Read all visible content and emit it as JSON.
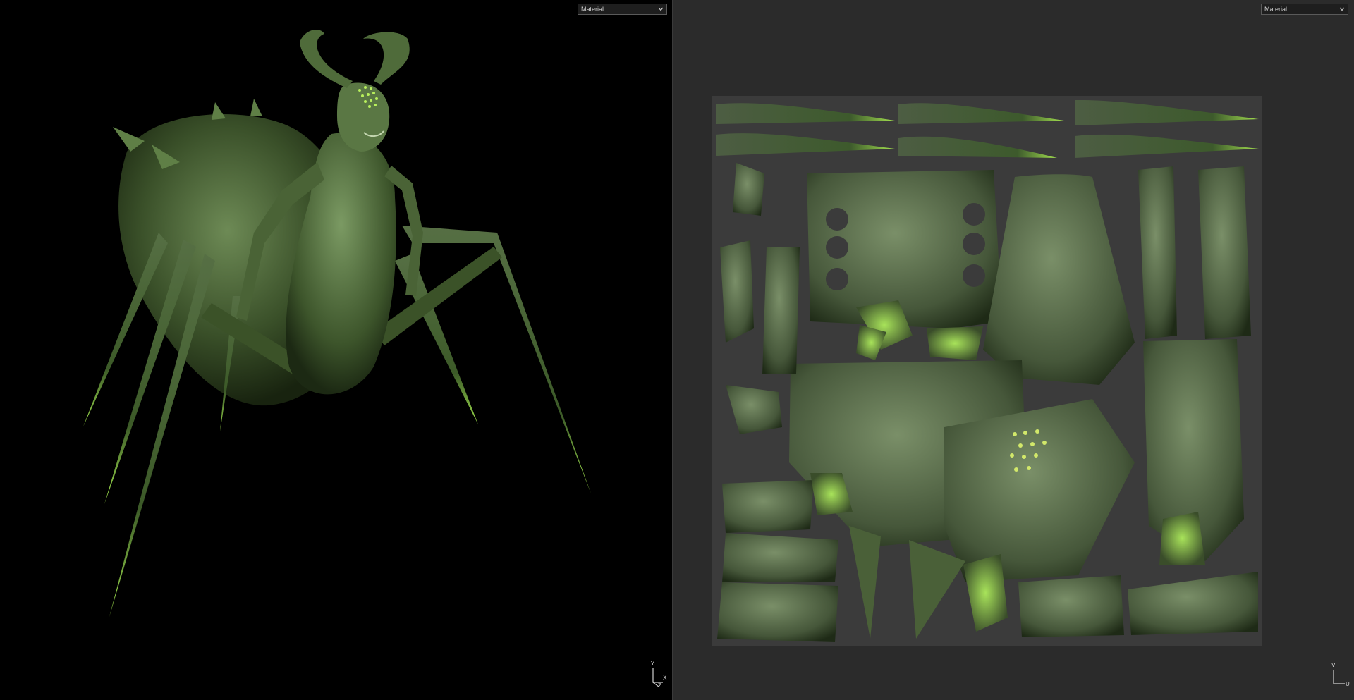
{
  "left_viewport": {
    "shading_mode": {
      "selected": "Material"
    },
    "axis_gizmo": {
      "labels": [
        "Y",
        "X",
        "Z"
      ]
    }
  },
  "right_viewport": {
    "shading_mode": {
      "selected": "Material"
    },
    "axis_gizmo": {
      "labels": [
        "V",
        "U"
      ]
    }
  },
  "icons": [
    "chevron-down-icon",
    "axis-gizmo-icon"
  ],
  "colors": {
    "viewport_3d_bg": "#000000",
    "viewport_uv_bg": "#2b2b2b",
    "uv_sheet": "#3b3b3b",
    "model_green": "#4f6b3e",
    "glow_green": "#9fe04a"
  }
}
